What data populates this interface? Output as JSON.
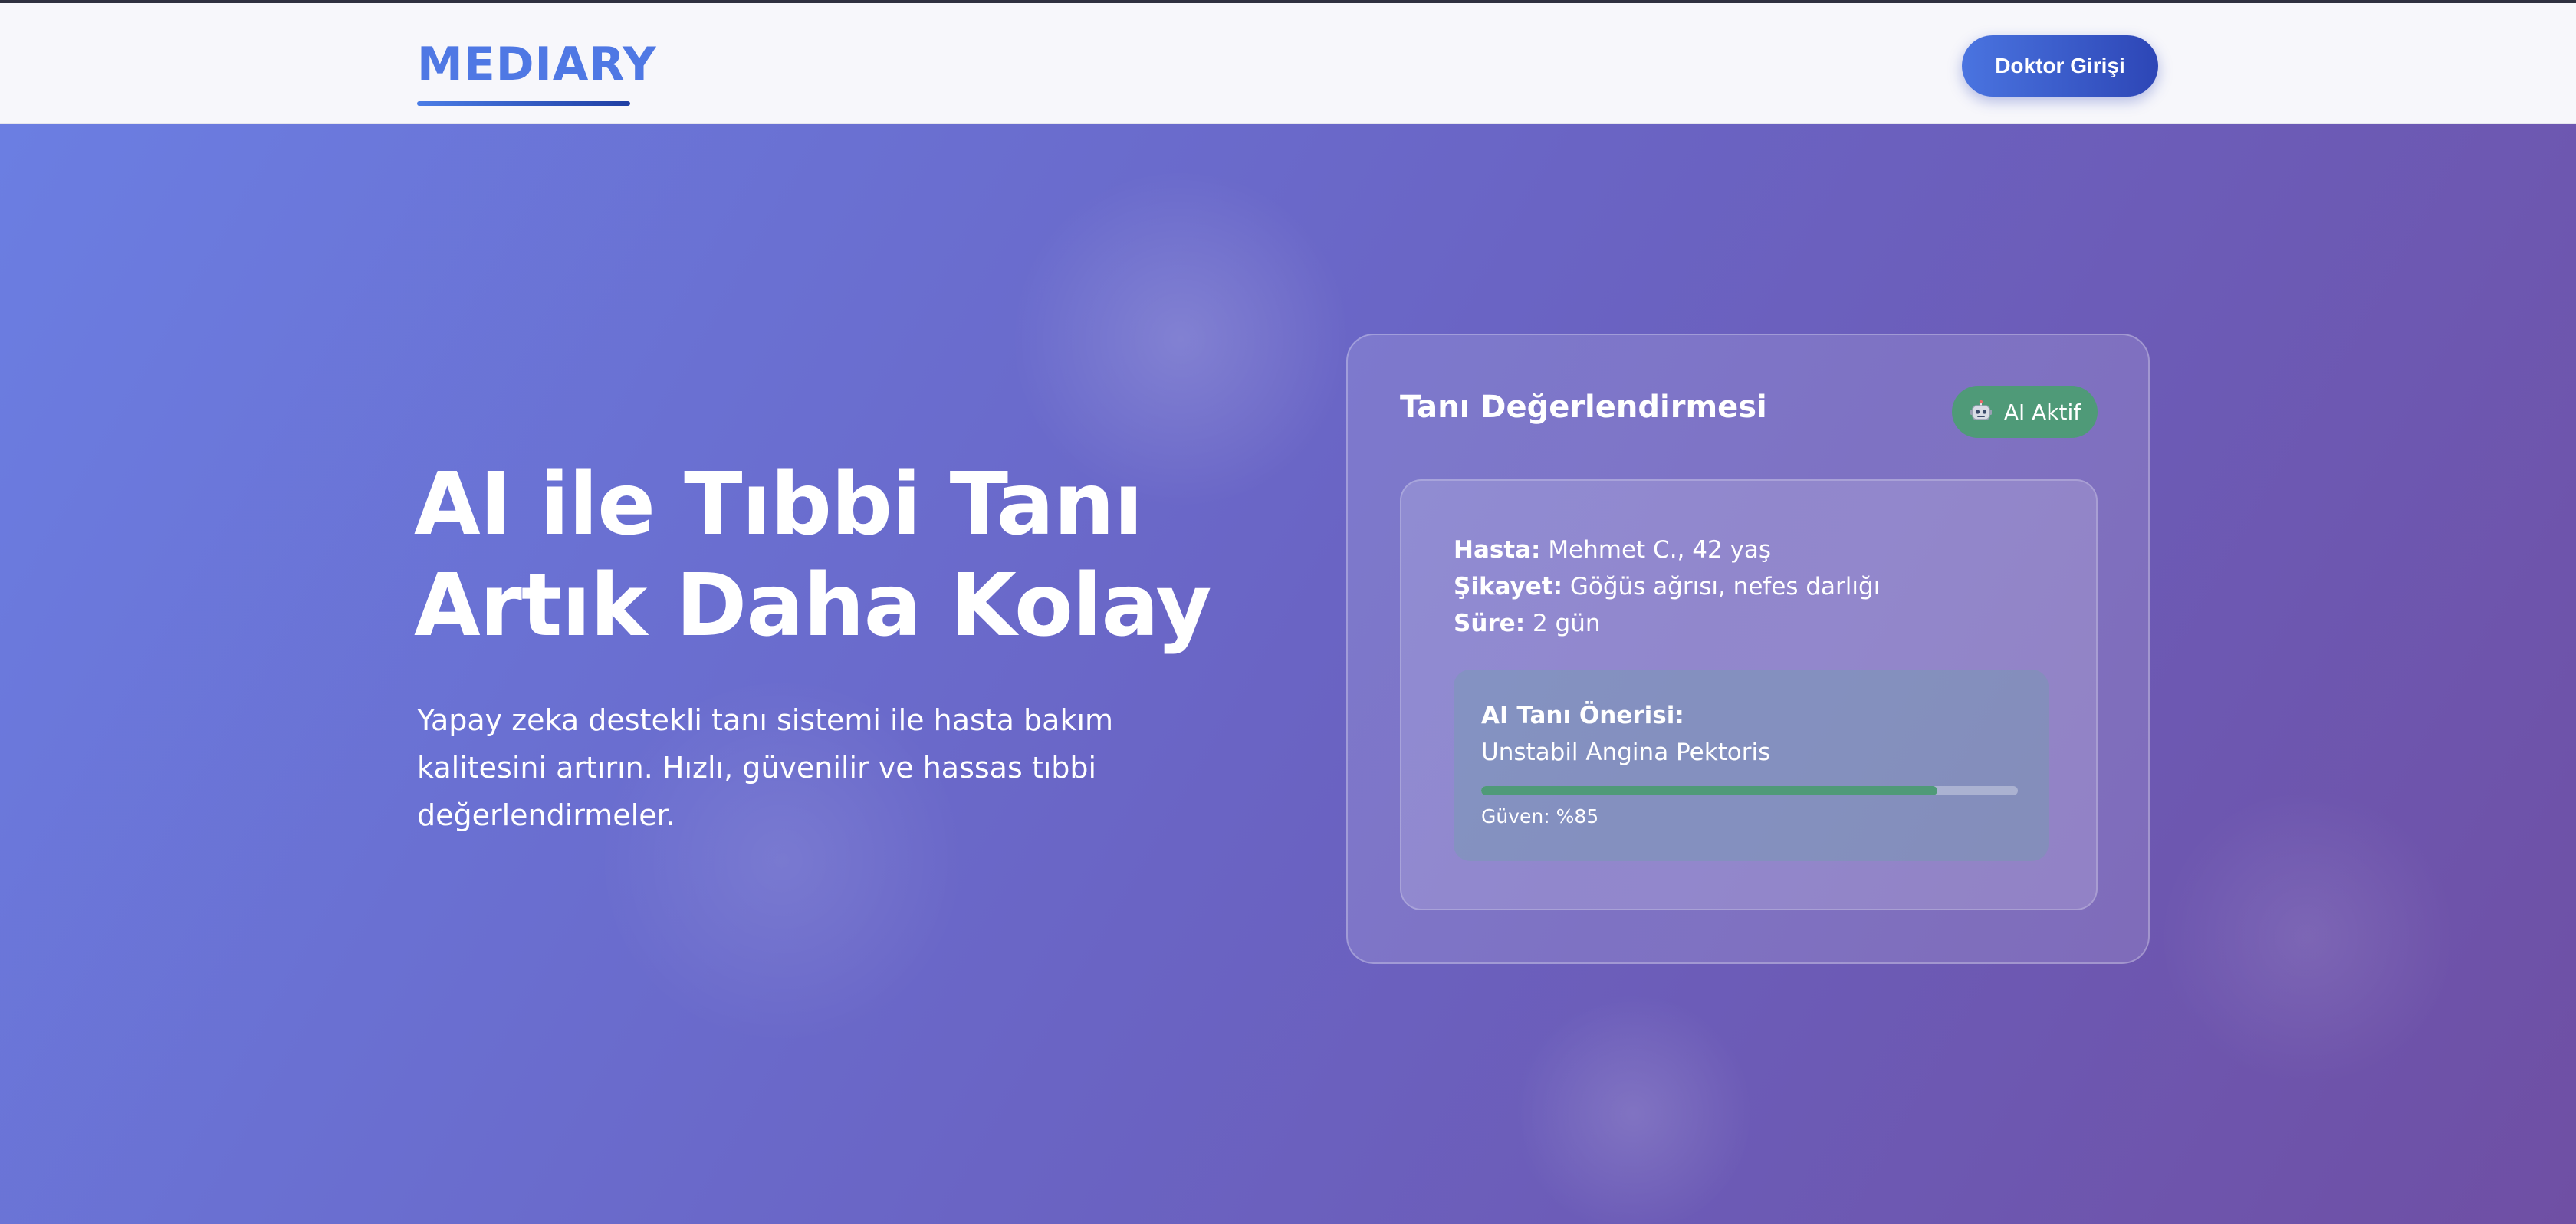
{
  "header": {
    "logo": "MEDIARY",
    "login_button": "Doktor Girişi"
  },
  "hero": {
    "title_line1": "AI ile Tıbbi Tanı",
    "title_line2": "Artık Daha Kolay",
    "description": "Yapay zeka destekli tanı sistemi ile hasta bakım kalitesini artırın. Hızlı, güvenilir ve hassas tıbbi değerlendirmeler."
  },
  "card": {
    "title": "Tanı Değerlendirmesi",
    "badge_icon": "robot-icon",
    "badge_label": "AI Aktif",
    "patient_label": "Hasta:",
    "patient_value": "Mehmet C., 42 yaş",
    "complaint_label": "Şikayet:",
    "complaint_value": "Göğüs ağrısı, nefes darlığı",
    "duration_label": "Süre:",
    "duration_value": "2 gün",
    "ai_label": "AI Tanı Önerisi:",
    "ai_diagnosis": "Unstabil Angina Pektoris",
    "confidence_percent": 85,
    "confidence_text": "Güven: %85"
  },
  "colors": {
    "brand": "#4f78e4",
    "button": "#3a5fd0",
    "badge": "#4f9a78",
    "gradient_start": "#6b7ee2",
    "gradient_end": "#6f4fa4"
  }
}
